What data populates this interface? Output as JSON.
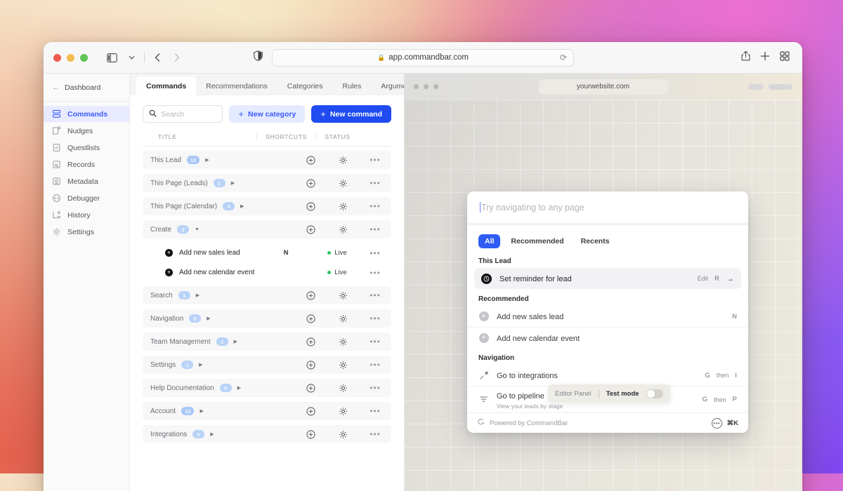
{
  "browser": {
    "url": "app.commandbar.com",
    "lock_icon": "lock-icon",
    "reload_icon": "reload-icon",
    "sidebar_toggle_icon": "sidebar-toggle-icon",
    "chevron_down_icon": "chevron-down-icon",
    "back_icon": "back-arrow-icon",
    "forward_icon": "forward-arrow-icon",
    "shield_icon": "privacy-shield-icon",
    "share_icon": "share-icon",
    "new_tab_icon": "plus-icon",
    "tab_overview_icon": "tab-grid-icon"
  },
  "sidebar": {
    "back_label": "Dashboard",
    "items": [
      {
        "label": "Commands",
        "icon": "commands-icon",
        "active": true
      },
      {
        "label": "Nudges",
        "icon": "nudges-icon",
        "active": false
      },
      {
        "label": "Questlists",
        "icon": "questlists-icon",
        "active": false
      },
      {
        "label": "Records",
        "icon": "records-icon",
        "active": false
      },
      {
        "label": "Metadata",
        "icon": "metadata-icon",
        "active": false
      },
      {
        "label": "Debugger",
        "icon": "debugger-icon",
        "active": false
      },
      {
        "label": "History",
        "icon": "history-icon",
        "active": false
      },
      {
        "label": "Settings",
        "icon": "settings-icon",
        "active": false
      }
    ]
  },
  "tabs": [
    {
      "label": "Commands",
      "active": true
    },
    {
      "label": "Recommendations",
      "active": false
    },
    {
      "label": "Categories",
      "active": false
    },
    {
      "label": "Rules",
      "active": false
    },
    {
      "label": "Arguments",
      "active": false
    }
  ],
  "toolbar": {
    "search_placeholder": "Search",
    "search_value": "",
    "new_category_label": "New category",
    "new_command_label": "New command"
  },
  "table": {
    "headers": {
      "title": "TITLE",
      "shortcuts": "SHORTCUTS",
      "status": "STATUS"
    },
    "groups": [
      {
        "name": "This Lead",
        "count": "10",
        "expanded": false,
        "commands": []
      },
      {
        "name": "This Page (Leads)",
        "count": "1",
        "expanded": false,
        "commands": []
      },
      {
        "name": "This Page (Calendar)",
        "count": "4",
        "expanded": false,
        "commands": []
      },
      {
        "name": "Create",
        "count": "2",
        "expanded": true,
        "commands": [
          {
            "title": "Add new sales lead",
            "shortcut": "N",
            "status": "Live"
          },
          {
            "title": "Add new calendar event",
            "shortcut": "",
            "status": "Live"
          }
        ]
      },
      {
        "name": "Search",
        "count": "1",
        "expanded": false,
        "commands": []
      },
      {
        "name": "Navigation",
        "count": "9",
        "expanded": false,
        "commands": []
      },
      {
        "name": "Team Management",
        "count": "2",
        "expanded": false,
        "commands": []
      },
      {
        "name": "Settings",
        "count": "1",
        "expanded": false,
        "commands": []
      },
      {
        "name": "Help Documentation",
        "count": "5",
        "expanded": false,
        "commands": []
      },
      {
        "name": "Account",
        "count": "10",
        "expanded": false,
        "commands": []
      },
      {
        "name": "Integrations",
        "count": "5",
        "expanded": false,
        "commands": []
      }
    ]
  },
  "site": {
    "url": "yourwebsite.com"
  },
  "palette": {
    "input_placeholder": "Try navigating to any page",
    "input_value": "",
    "tabs": [
      {
        "label": "All",
        "active": true
      },
      {
        "label": "Recommended",
        "active": false
      },
      {
        "label": "Recents",
        "active": false
      }
    ],
    "sections": [
      {
        "title": "This Lead",
        "items": [
          {
            "label": "Set reminder for lead",
            "sub": "",
            "icon": "clock-icon",
            "selected": true,
            "edit_label": "Edit",
            "key1": "R",
            "arrow": "→"
          }
        ]
      },
      {
        "title": "Recommended",
        "items": [
          {
            "label": "Add new sales lead",
            "sub": "",
            "icon": "plus-circle-icon",
            "selected": false,
            "key1": "N"
          },
          {
            "label": "Add new calendar event",
            "sub": "",
            "icon": "plus-circle-icon",
            "selected": false,
            "key1": ""
          }
        ]
      },
      {
        "title": "Navigation",
        "items": [
          {
            "label": "Go to integrations",
            "sub": "",
            "icon": "plug-icon",
            "selected": false,
            "key1": "G",
            "then": "then",
            "key2": "I"
          },
          {
            "label": "Go to pipeline",
            "sub": "View your leads by stage",
            "icon": "funnel-icon",
            "selected": false,
            "key1": "G",
            "then": "then",
            "key2": "P"
          }
        ]
      }
    ],
    "footer": {
      "powered_by": "Powered by CommandBar",
      "chat_icon": "chat-icon",
      "shortcut": "⌘K"
    }
  },
  "editor_bar": {
    "editor_panel_label": "Editor Panel",
    "test_mode_label": "Test mode",
    "test_mode_on": false
  },
  "colors": {
    "accent_blue": "#1f4bf0",
    "accent_blue_soft": "#e4eaff",
    "palette_blue": "#2f5cf5",
    "live_green": "#2fc463",
    "badge_blue": "#a9c8f5"
  }
}
